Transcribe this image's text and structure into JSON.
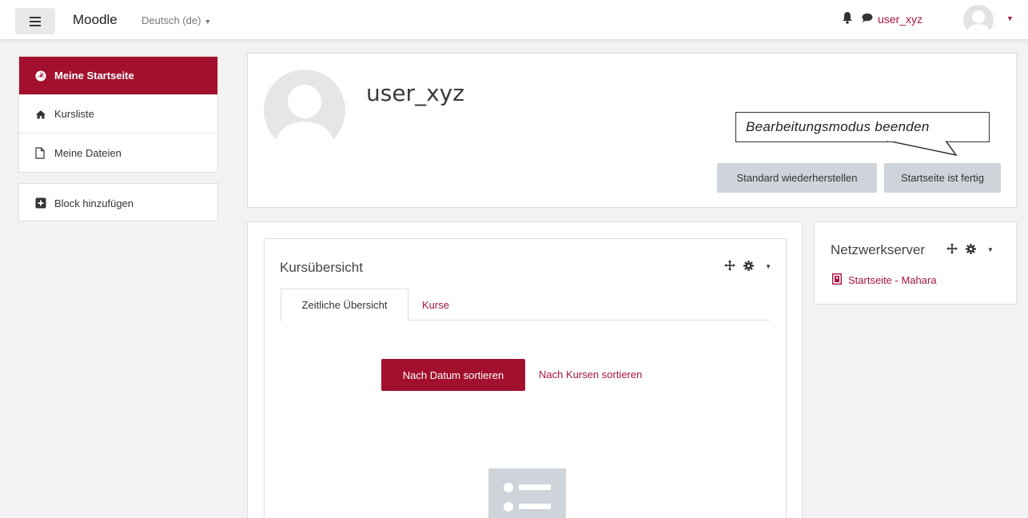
{
  "header": {
    "menu_icon": "hamburger-icon",
    "brand": "Moodle",
    "language": "Deutsch (de)",
    "username": "user_xyz",
    "icons": [
      "bell-icon",
      "chat-icon",
      "caret-down-icon"
    ]
  },
  "nav": {
    "items": [
      {
        "label": "Meine Startseite",
        "icon": "dashboard-icon",
        "active": true
      },
      {
        "label": "Kursliste",
        "icon": "home-icon"
      },
      {
        "label": "Meine Dateien",
        "icon": "file-icon"
      }
    ],
    "add_block": {
      "label": "Block hinzufügen",
      "icon": "plus-square-icon"
    }
  },
  "profile": {
    "name": "user_xyz",
    "callout": "Bearbeitungsmodus beenden",
    "reset_button": "Standard wiederherstellen",
    "done_button": "Startseite ist fertig"
  },
  "course_overview": {
    "title": "Kursübersicht",
    "tabs": [
      "Zeitliche Übersicht",
      "Kurse"
    ],
    "sort_by_date": "Nach Datum sortieren",
    "sort_by_course": "Nach Kursen sortieren"
  },
  "network": {
    "title": "Netzwerkserver",
    "link": "Startseite - Mahara"
  },
  "colors": {
    "accent": "#a3102d",
    "link": "#a5153e",
    "button_gray": "#ced4da",
    "background": "#f2f2f2"
  }
}
